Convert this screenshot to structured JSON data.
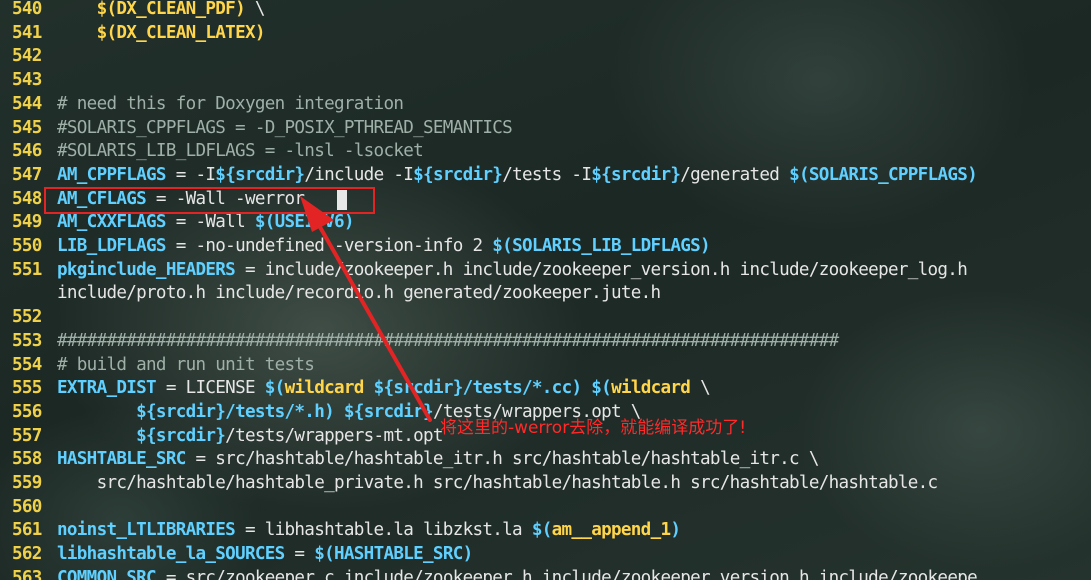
{
  "lines": [
    {
      "no": "540",
      "tokens": [
        {
          "t": "    "
        },
        {
          "t": "$(DX_CLEAN_PDF)",
          "c": "var"
        },
        {
          "t": " \\"
        }
      ]
    },
    {
      "no": "541",
      "tokens": [
        {
          "t": "    "
        },
        {
          "t": "$(DX_CLEAN_LATEX)",
          "c": "var"
        }
      ]
    },
    {
      "no": "542",
      "tokens": []
    },
    {
      "no": "543",
      "tokens": []
    },
    {
      "no": "544",
      "tokens": [
        {
          "t": "# need this for Doxygen integration",
          "c": "comment"
        }
      ]
    },
    {
      "no": "545",
      "tokens": [
        {
          "t": "#SOLARIS_CPPFLAGS = -D_POSIX_PTHREAD_SEMANTICS",
          "c": "comment"
        }
      ]
    },
    {
      "no": "546",
      "tokens": [
        {
          "t": "#SOLARIS_LIB_LDFLAGS = -lnsl -lsocket",
          "c": "comment"
        }
      ]
    },
    {
      "no": "547",
      "tokens": [
        {
          "t": "AM_CPPFLAGS",
          "c": "keyword"
        },
        {
          "t": " = -I"
        },
        {
          "t": "${srcdir}",
          "c": "keyword"
        },
        {
          "t": "/include -I"
        },
        {
          "t": "${srcdir}",
          "c": "keyword"
        },
        {
          "t": "/tests -I"
        },
        {
          "t": "${srcdir}",
          "c": "keyword"
        },
        {
          "t": "/generated "
        },
        {
          "t": "$(SOLARIS_CPPFLAGS)",
          "c": "keyword"
        }
      ]
    },
    {
      "no": "548",
      "tokens": [
        {
          "t": "AM_CFLAGS",
          "c": "keyword"
        },
        {
          "t": " = -Wall -werror"
        }
      ]
    },
    {
      "no": "549",
      "tokens": [
        {
          "t": "AM_CXXFLAGS",
          "c": "keyword"
        },
        {
          "t": " = -Wall "
        },
        {
          "t": "$(USEIPV6)",
          "c": "keyword"
        }
      ]
    },
    {
      "no": "550",
      "tokens": [
        {
          "t": "LIB_LDFLAGS",
          "c": "keyword"
        },
        {
          "t": " = -no-undefined -version-info 2 "
        },
        {
          "t": "$(SOLARIS_LIB_LDFLAGS)",
          "c": "keyword"
        }
      ]
    },
    {
      "no": "551",
      "tokens": [
        {
          "t": "pkginclude_HEADERS",
          "c": "keyword"
        },
        {
          "t": " = include/zookeeper.h include/zookeeper_version.h include/zookeeper_log.h"
        }
      ]
    },
    {
      "no": "",
      "tokens": [
        {
          "t": "include/proto.h include/recordio.h generated/zookeeper.jute.h"
        }
      ]
    },
    {
      "no": "552",
      "tokens": []
    },
    {
      "no": "553",
      "tokens": [
        {
          "t": "###############################################################################",
          "c": "comment"
        }
      ]
    },
    {
      "no": "554",
      "tokens": [
        {
          "t": "# build and run unit tests",
          "c": "comment"
        }
      ]
    },
    {
      "no": "555",
      "tokens": [
        {
          "t": "EXTRA_DIST",
          "c": "keyword"
        },
        {
          "t": " = LICENSE "
        },
        {
          "t": "$(",
          "c": "keyword"
        },
        {
          "t": "wildcard",
          "c": "var"
        },
        {
          "t": " "
        },
        {
          "t": "${srcdir}",
          "c": "keyword"
        },
        {
          "t": "/tests/*.cc)",
          "c": "keyword"
        },
        {
          "t": " "
        },
        {
          "t": "$(",
          "c": "keyword"
        },
        {
          "t": "wildcard",
          "c": "var"
        },
        {
          "t": " \\"
        }
      ]
    },
    {
      "no": "556",
      "tokens": [
        {
          "t": "        "
        },
        {
          "t": "${srcdir}",
          "c": "keyword"
        },
        {
          "t": "/tests/*.h)",
          "c": "keyword"
        },
        {
          "t": " "
        },
        {
          "t": "${srcdir}",
          "c": "keyword"
        },
        {
          "t": "/tests/wrappers.opt \\"
        }
      ]
    },
    {
      "no": "557",
      "tokens": [
        {
          "t": "        "
        },
        {
          "t": "${srcdir}",
          "c": "keyword"
        },
        {
          "t": "/tests/wrappers-mt.opt"
        }
      ]
    },
    {
      "no": "558",
      "tokens": [
        {
          "t": "HASHTABLE_SRC",
          "c": "keyword"
        },
        {
          "t": " = src/hashtable/hashtable_itr.h src/hashtable/hashtable_itr.c \\"
        }
      ]
    },
    {
      "no": "559",
      "tokens": [
        {
          "t": "    src/hashtable/hashtable_private.h src/hashtable/hashtable.h src/hashtable/hashtable.c"
        }
      ]
    },
    {
      "no": "560",
      "tokens": []
    },
    {
      "no": "561",
      "tokens": [
        {
          "t": "noinst_LTLIBRARIES",
          "c": "keyword"
        },
        {
          "t": " = libhashtable.la libzkst.la "
        },
        {
          "t": "$(",
          "c": "keyword"
        },
        {
          "t": "am__append_1",
          "c": "var"
        },
        {
          "t": ")",
          "c": "keyword"
        }
      ]
    },
    {
      "no": "562",
      "tokens": [
        {
          "t": "libhashtable_la_SOURCES",
          "c": "keyword"
        },
        {
          "t": " = "
        },
        {
          "t": "$(HASHTABLE_SRC)",
          "c": "keyword"
        }
      ]
    },
    {
      "no": "563",
      "tokens": [
        {
          "t": "COMMON_SRC",
          "c": "keyword"
        },
        {
          "t": " = src/zookeeper.c include/zookeeper.h include/zookeeper_version.h include/zookeepe"
        }
      ]
    }
  ],
  "annotation": {
    "note": "将这里的-werror去除，就能编译成功了!"
  },
  "colors": {
    "line_number": "#f0d24a",
    "comment": "#9fb0a8",
    "keyword": "#5fd0ff",
    "variable": "#ffd54a",
    "text": "#e6e6e6",
    "annotation": "#e22424"
  }
}
